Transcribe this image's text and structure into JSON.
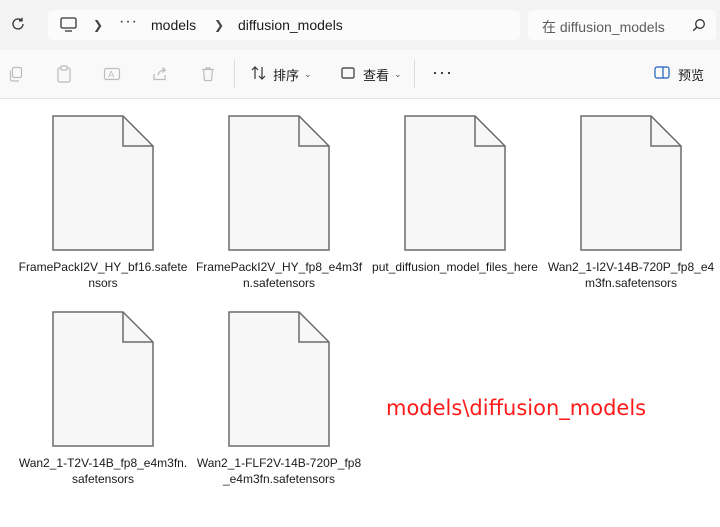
{
  "address": {
    "crumbs": [
      "models",
      "diffusion_models"
    ],
    "overflow": "···"
  },
  "search": {
    "placeholder": "在 diffusion_models"
  },
  "toolbar": {
    "sort_label": "排序",
    "view_label": "查看",
    "more": "···",
    "preview_label": "预览"
  },
  "files": [
    {
      "name": "FramePackI2V_HY_bf16.safetensors"
    },
    {
      "name": "FramePackI2V_HY_fp8_e4m3fn.safetensors"
    },
    {
      "name": "put_diffusion_model_files_here"
    },
    {
      "name": "Wan2_1-I2V-14B-720P_fp8_e4m3fn.safetensors"
    },
    {
      "name": "Wan2_1-T2V-14B_fp8_e4m3fn.safetensors"
    },
    {
      "name": "Wan2_1-FLF2V-14B-720P_fp8_e4m3fn.safetensors"
    }
  ],
  "annotation": "models\\diffusion_models",
  "colors": {
    "annotation": "#ff1a1a",
    "toolbar_bg": "#f9f9f9",
    "address_bg": "#f3f3f3"
  }
}
